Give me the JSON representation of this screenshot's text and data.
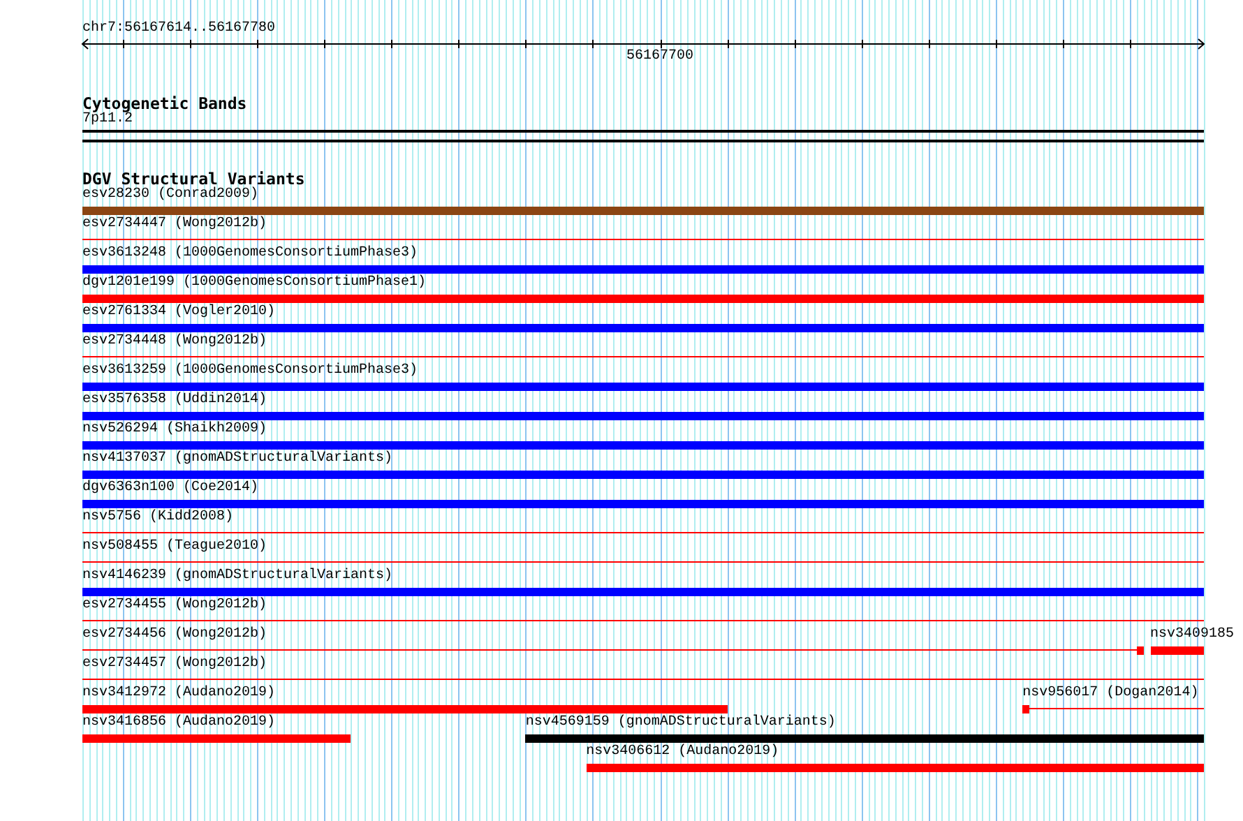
{
  "view": {
    "position": "chr7:56167614..56167780"
  },
  "ruler": {
    "tick_label": "56167700"
  },
  "tracks": [
    {
      "title": "Cytogenetic Bands",
      "kind": "bands",
      "band": "7p11.2"
    },
    {
      "title": "DGV Structural Variants",
      "kind": "features",
      "rows": [
        {
          "features": [
            {
              "label": "esv28230 (Conrad2009)",
              "color": "#8b4513",
              "kind": "thick"
            }
          ]
        },
        {
          "features": [
            {
              "label": "esv2734447 (Wong2012b)",
              "color": "#ff0000",
              "kind": "thin"
            }
          ]
        },
        {
          "features": [
            {
              "label": "esv3613248 (1000GenomesConsortiumPhase3)",
              "color": "#0000ff",
              "kind": "thick"
            }
          ]
        },
        {
          "features": [
            {
              "label": "dgv1201e199 (1000GenomesConsortiumPhase1)",
              "color": "#ff0000",
              "kind": "thick"
            }
          ]
        },
        {
          "features": [
            {
              "label": "esv2761334 (Vogler2010)",
              "color": "#0000ff",
              "kind": "thick"
            }
          ]
        },
        {
          "features": [
            {
              "label": "esv2734448 (Wong2012b)",
              "color": "#ff0000",
              "kind": "thin"
            }
          ]
        },
        {
          "features": [
            {
              "label": "esv3613259 (1000GenomesConsortiumPhase3)",
              "color": "#0000ff",
              "kind": "thick"
            }
          ]
        },
        {
          "features": [
            {
              "label": "esv3576358 (Uddin2014)",
              "color": "#0000ff",
              "kind": "thick"
            }
          ]
        },
        {
          "features": [
            {
              "label": "nsv526294 (Shaikh2009)",
              "color": "#0000ff",
              "kind": "thick"
            }
          ]
        },
        {
          "features": [
            {
              "label": "nsv4137037 (gnomADStructuralVariants)",
              "color": "#0000ff",
              "kind": "thick"
            }
          ]
        },
        {
          "features": [
            {
              "label": "dgv6363n100 (Coe2014)",
              "color": "#0000ff",
              "kind": "thick"
            }
          ]
        },
        {
          "features": [
            {
              "label": "nsv5756 (Kidd2008)",
              "color": "#ff0000",
              "kind": "thin"
            }
          ]
        },
        {
          "features": [
            {
              "label": "nsv508455 (Teague2010)",
              "color": "#ff0000",
              "kind": "thin"
            }
          ]
        },
        {
          "features": [
            {
              "label": "nsv4146239 (gnomADStructuralVariants)",
              "color": "#0000ff",
              "kind": "thick"
            }
          ]
        },
        {
          "features": [
            {
              "label": "esv2734455 (Wong2012b)",
              "color": "#ff0000",
              "kind": "thin"
            }
          ]
        },
        {
          "features": [
            {
              "label": "esv2734456 (Wong2012b)",
              "color": "#ff0000",
              "kind": "thin-block"
            },
            {
              "label": "nsv3409185",
              "color": "#ff0000",
              "kind": "thick"
            }
          ]
        },
        {
          "features": [
            {
              "label": "esv2734457 (Wong2012b)",
              "color": "#ff0000",
              "kind": "thin"
            }
          ]
        },
        {
          "features": [
            {
              "label": "nsv3412972 (Audano2019)",
              "color": "#ff0000",
              "kind": "thick"
            },
            {
              "label": "nsv956017 (Dogan2014)",
              "color": "#ff0000",
              "kind": "block-thin"
            }
          ]
        },
        {
          "features": [
            {
              "label": "nsv3416856 (Audano2019)",
              "color": "#ff0000",
              "kind": "thick"
            },
            {
              "label": "nsv4569159 (gnomADStructuralVariants)",
              "color": "#000000",
              "kind": "thick"
            }
          ]
        },
        {
          "features": [
            {
              "label": "nsv3406612 (Audano2019)",
              "color": "#ff0000",
              "kind": "thick"
            }
          ]
        }
      ]
    }
  ]
}
